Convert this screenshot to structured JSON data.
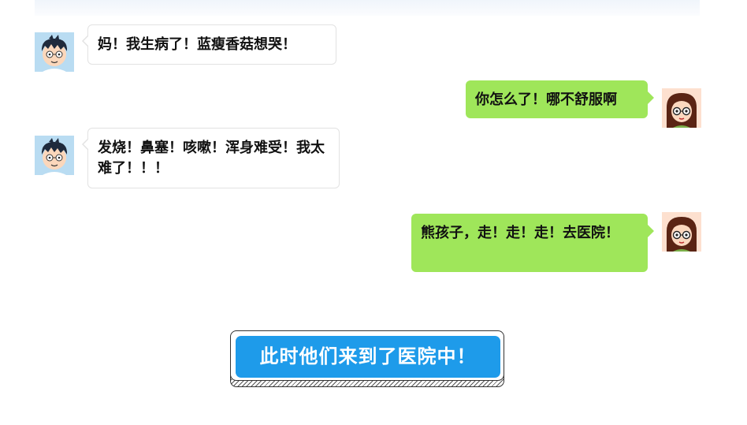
{
  "chat": {
    "messages": [
      {
        "sender": "boy",
        "side": "left",
        "text": "妈！我生病了！蓝瘦香菇想哭！"
      },
      {
        "sender": "mom",
        "side": "right",
        "text": "你怎么了！哪不舒服啊"
      },
      {
        "sender": "boy",
        "side": "left",
        "text": "发烧！鼻塞！咳嗽！浑身难受！我太难了！！！"
      },
      {
        "sender": "mom",
        "side": "right",
        "text": "熊孩子，走！走！走！去医院！"
      }
    ]
  },
  "banner": {
    "text": "此时他们来到了医院中！"
  },
  "icons": {
    "boy_avatar": "cartoon-boy-avatar",
    "mom_avatar": "cartoon-girl-avatar"
  },
  "colors": {
    "left_bubble": "#ffffff",
    "right_bubble": "#9fe65a",
    "banner": "#1e9bea",
    "banner_text": "#ffffff"
  }
}
